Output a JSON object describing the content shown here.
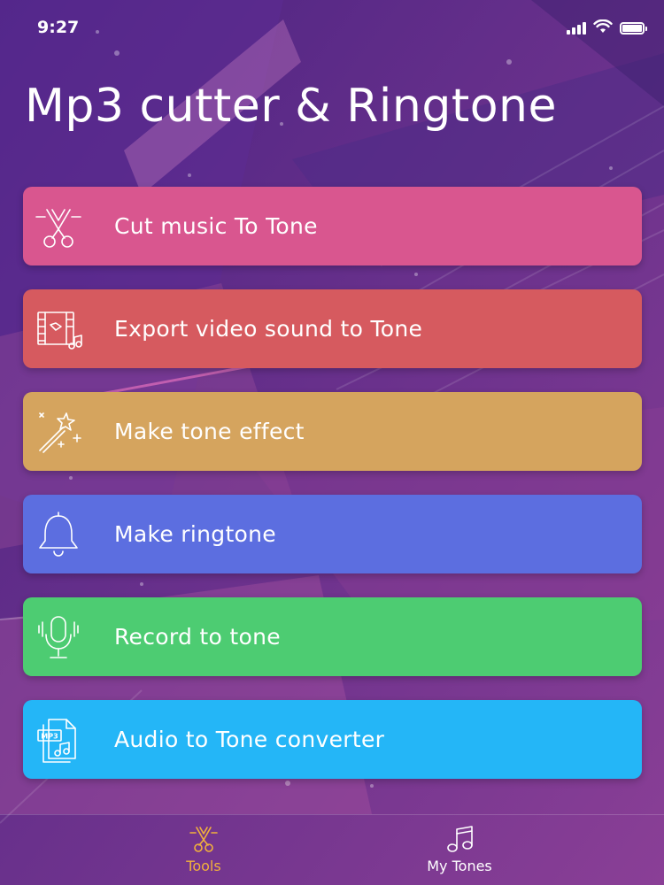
{
  "status_bar": {
    "time": "9:27"
  },
  "app": {
    "title": "Mp3 cutter & Ringtone"
  },
  "menu": [
    {
      "label": "Cut music To Tone",
      "icon": "scissors-icon",
      "color": "#d9568f"
    },
    {
      "label": "Export video sound to Tone",
      "icon": "film-music-icon",
      "color": "#d65a5f"
    },
    {
      "label": "Make tone effect",
      "icon": "magic-wand-icon",
      "color": "#d5a45e"
    },
    {
      "label": "Make ringtone",
      "icon": "bell-icon",
      "color": "#5c6ee0"
    },
    {
      "label": "Record to tone",
      "icon": "microphone-icon",
      "color": "#4dcc72"
    },
    {
      "label": "Audio to Tone converter",
      "icon": "mp3-file-icon",
      "color": "#24b6f7"
    }
  ],
  "tabbar": {
    "tabs": [
      {
        "label": "Tools",
        "icon": "scissors-icon",
        "active": true,
        "color": "#f2b13c"
      },
      {
        "label": "My Tones",
        "icon": "music-note-icon",
        "active": false,
        "color": "#ffffff"
      }
    ]
  }
}
